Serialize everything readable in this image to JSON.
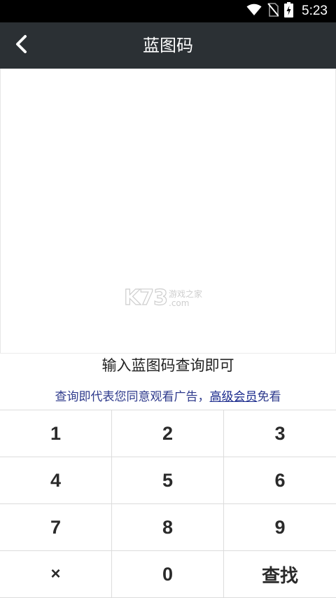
{
  "status_bar": {
    "time": "5:23",
    "icons": [
      "wifi-icon",
      "no-sim-icon",
      "battery-charging-icon"
    ]
  },
  "toolbar": {
    "title": "蓝图码",
    "back_icon": "chevron-left-icon"
  },
  "watermark": {
    "logo_text": "K73",
    "cn_text": "游戏之家",
    "domain_text": ".com"
  },
  "hint": {
    "title": "输入蓝图码查询即可",
    "note_prefix": "查询即代表您同意观看广告，",
    "note_link": "高级会员",
    "note_suffix": "免看"
  },
  "keypad": {
    "keys": [
      "1",
      "2",
      "3",
      "4",
      "5",
      "6",
      "7",
      "8",
      "9",
      "×",
      "0",
      "查找"
    ]
  },
  "colors": {
    "toolbar_bg": "#2b3034",
    "status_bar_bg": "#000000",
    "note_text": "#2e3a8c"
  }
}
